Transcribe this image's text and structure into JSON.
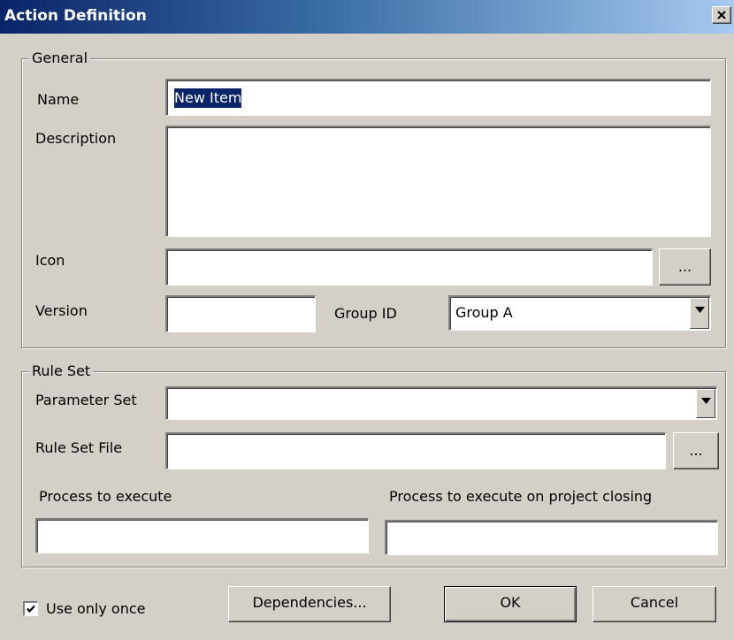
{
  "window": {
    "title": "Action Definition"
  },
  "general": {
    "legend": "General",
    "name_label": "Name",
    "name_value": "New Item",
    "description_label": "Description",
    "description_value": "",
    "icon_label": "Icon",
    "icon_value": "",
    "icon_browse_label": "...",
    "version_label": "Version",
    "version_value": "",
    "group_id_label": "Group ID",
    "group_id_value": "Group A"
  },
  "rule_set": {
    "legend": "Rule Set",
    "parameter_set_label": "Parameter Set",
    "parameter_set_value": "",
    "rule_set_file_label": "Rule Set File",
    "rule_set_file_value": "",
    "rule_set_file_browse_label": "...",
    "process_label": "Process to execute",
    "process_value": "",
    "process_closing_label": "Process to execute on project closing",
    "process_closing_value": ""
  },
  "footer": {
    "use_only_once_label": "Use only once",
    "use_only_once_checked": true,
    "dependencies_label": "Dependencies...",
    "ok_label": "OK",
    "cancel_label": "Cancel"
  }
}
